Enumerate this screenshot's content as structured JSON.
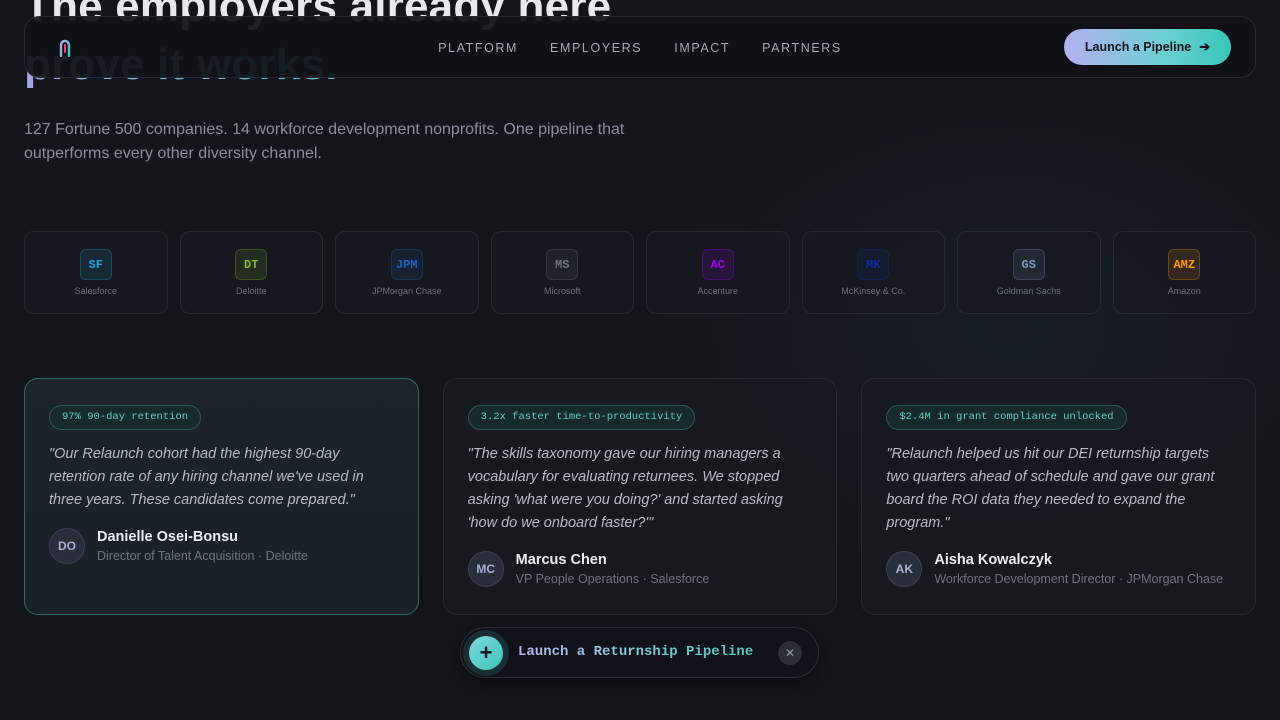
{
  "hero": {
    "title_line1": "The employers already here",
    "title_line2": "prove it works.",
    "subtitle": "127 Fortune 500 companies. 14 workforce development nonprofits. One pipeline that outperforms every other diversity channel."
  },
  "nav": {
    "links": [
      "PLATFORM",
      "EMPLOYERS",
      "IMPACT",
      "PARTNERS"
    ],
    "cta_label": "Launch a Pipeline",
    "cta_icon": "arrow-right-icon"
  },
  "employers": [
    {
      "abbr": "SF",
      "name": "Salesforce",
      "color": "#1aa6e0"
    },
    {
      "abbr": "DT",
      "name": "Deloitte",
      "color": "#86bc25"
    },
    {
      "abbr": "JPM",
      "name": "JPMorgan Chase",
      "color": "#1565c0"
    },
    {
      "abbr": "MS",
      "name": "Microsoft",
      "color": "#6e7480"
    },
    {
      "abbr": "AC",
      "name": "Accenture",
      "color": "#a100ff"
    },
    {
      "abbr": "MK",
      "name": "McKinsey & Co.",
      "color": "#0b2fa0"
    },
    {
      "abbr": "GS",
      "name": "Goldman Sachs",
      "color": "#7f9ac0"
    },
    {
      "abbr": "AMZ",
      "name": "Amazon",
      "color": "#ff9900"
    }
  ],
  "testimonials": [
    {
      "stat": "97% 90-day retention",
      "quote": "\"Our Relaunch cohort had the highest 90-day retention rate of any hiring channel we've used in three years. These candidates come prepared.\"",
      "initials": "DO",
      "name": "Danielle Osei-Bonsu",
      "role": "Director of Talent Acquisition · Deloitte"
    },
    {
      "stat": "3.2x faster time-to-productivity",
      "quote": "\"The skills taxonomy gave our hiring managers a vocabulary for evaluating returnees. We stopped asking 'what were you doing?' and started asking 'how do we onboard faster?'\"",
      "initials": "MC",
      "name": "Marcus Chen",
      "role": "VP People Operations · Salesforce"
    },
    {
      "stat": "$2.4M in grant compliance unlocked",
      "quote": "\"Relaunch helped us hit our DEI returnship targets two quarters ahead of schedule and gave our grant board the ROI data they needed to expand the program.\"",
      "initials": "AK",
      "name": "Aisha Kowalczyk",
      "role": "Workforce Development Director · JPMorgan Chase"
    }
  ],
  "floating_cta": {
    "label": "Launch a Returnship Pipeline",
    "plus_icon": "plus-icon",
    "close_icon": "close-icon",
    "plus_symbol": "+",
    "close_symbol": "✕"
  },
  "colors": {
    "accent_teal": "#3ec4b4",
    "accent_lavender": "#b5b0f0",
    "background": "#14151b"
  }
}
